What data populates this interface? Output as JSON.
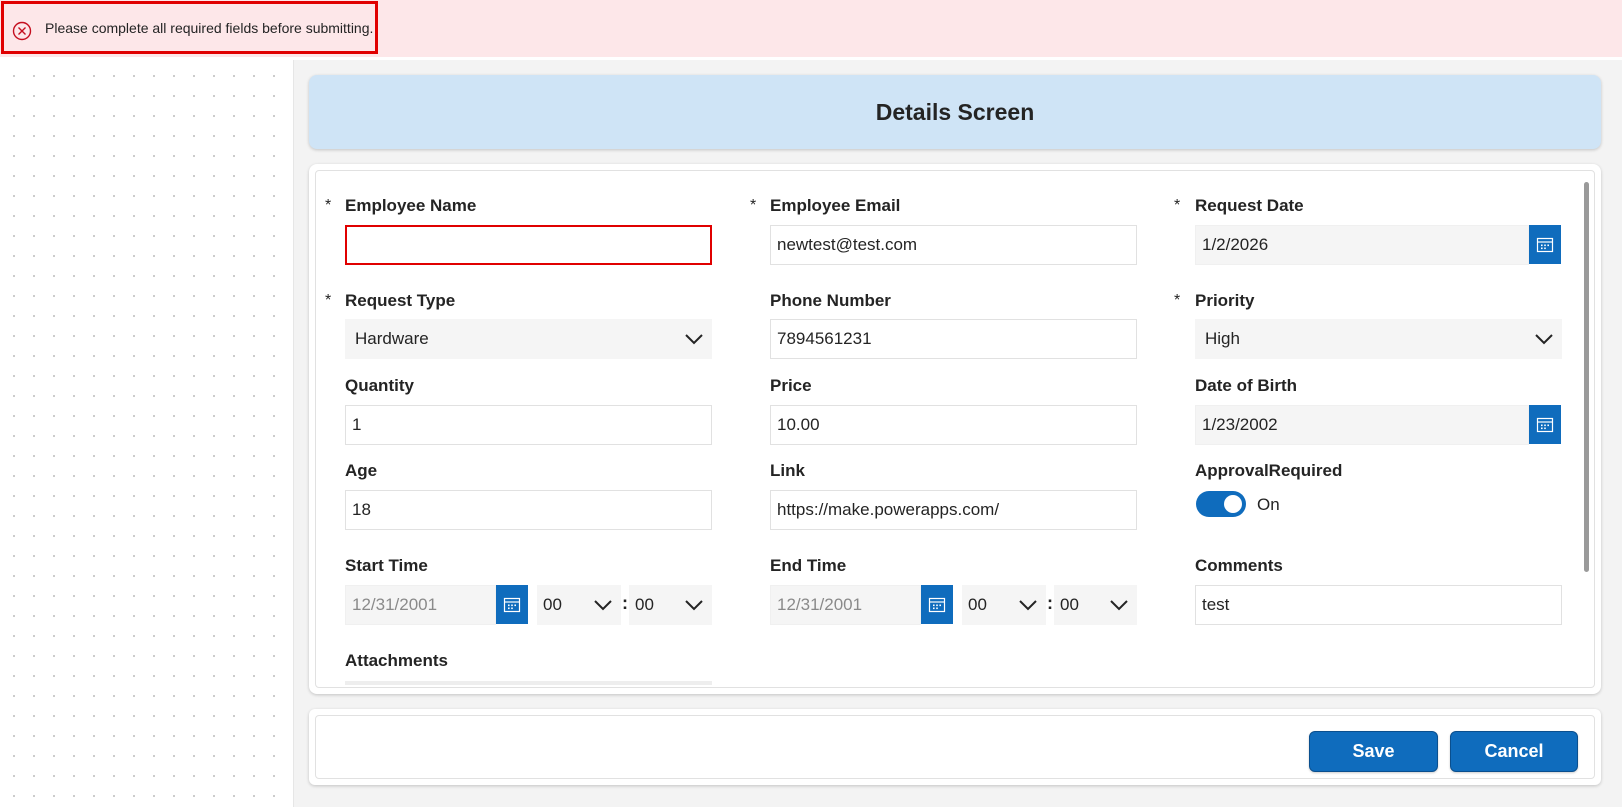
{
  "error_banner": {
    "message": "Please complete all required fields before submitting.",
    "icon": "error-circle-x-icon",
    "color": "#e00000"
  },
  "header": {
    "title": "Details Screen"
  },
  "required_marker": "*",
  "fields": {
    "employee_name": {
      "label": "Employee Name",
      "value": "",
      "required": true,
      "error": true
    },
    "employee_email": {
      "label": "Employee Email",
      "value": "newtest@test.com",
      "required": true
    },
    "request_date": {
      "label": "Request Date",
      "value": "1/2/2026",
      "required": true,
      "icon": "calendar-icon"
    },
    "request_type": {
      "label": "Request Type",
      "value": "Hardware",
      "required": true
    },
    "phone_number": {
      "label": "Phone Number",
      "value": "7894561231"
    },
    "priority": {
      "label": "Priority",
      "value": "High",
      "required": true
    },
    "quantity": {
      "label": "Quantity",
      "value": "1"
    },
    "price": {
      "label": "Price",
      "value": "10.00"
    },
    "date_of_birth": {
      "label": "Date of Birth",
      "value": "1/23/2002",
      "icon": "calendar-icon"
    },
    "age": {
      "label": "Age",
      "value": "18"
    },
    "link": {
      "label": "Link",
      "value": "https://make.powerapps.com/"
    },
    "approval_required": {
      "label": "ApprovalRequired",
      "value": "On",
      "checked": true
    },
    "start_time": {
      "label": "Start Time",
      "date": "12/31/2001",
      "hour": "00",
      "minute": "00",
      "separator": ":"
    },
    "end_time": {
      "label": "End Time",
      "date": "12/31/2001",
      "hour": "00",
      "minute": "00",
      "separator": ":"
    },
    "comments": {
      "label": "Comments",
      "value": "test"
    },
    "attachments": {
      "label": "Attachments"
    }
  },
  "footer": {
    "save_label": "Save",
    "cancel_label": "Cancel"
  },
  "colors": {
    "accent": "#0f6cbd",
    "header_bg": "#cfe4f6",
    "error_bg": "#fde7e9"
  }
}
